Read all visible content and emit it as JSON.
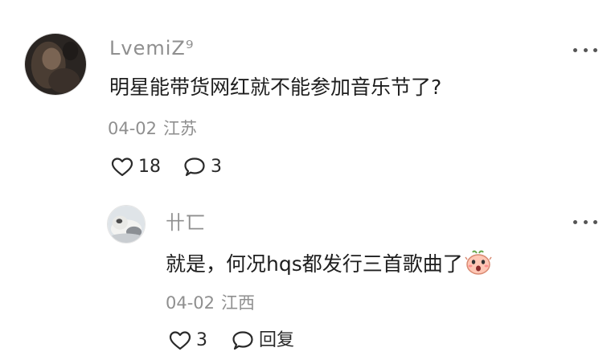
{
  "comment": {
    "username": "LvemiZ⁹",
    "text": "明星能带货网红就不能参加音乐节了?",
    "date": "04-02",
    "location": "江苏",
    "likes": "18",
    "replies": "3",
    "avatar_icon": "user-avatar-icon"
  },
  "reply": {
    "username": "卄匸",
    "text": "就是，何况hqs都发行三首歌曲了",
    "emoji_icon": "shocked-face-emoji-icon",
    "date": "04-02",
    "location": "江西",
    "likes": "3",
    "reply_label": "回复",
    "avatar_icon": "user-avatar-icon"
  },
  "colors": {
    "text": "#1e1e1e",
    "muted": "#8f8f8f",
    "icon": "#2a2a2a"
  }
}
